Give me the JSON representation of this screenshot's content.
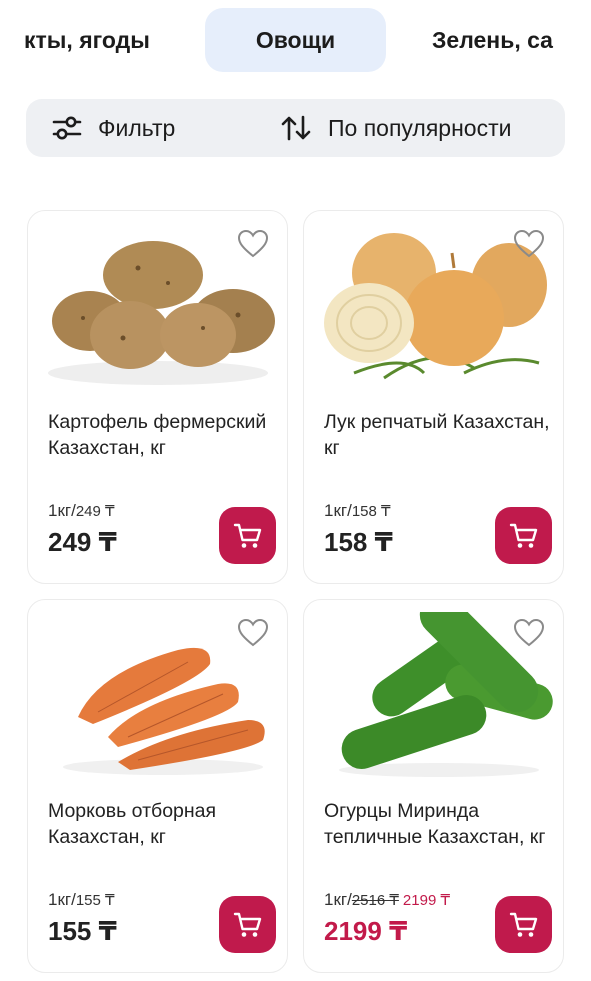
{
  "tabs": [
    {
      "label": "кты, ягоды"
    },
    {
      "label": "Овощи"
    },
    {
      "label": "Зелень, са"
    }
  ],
  "filter_bar": {
    "filter_label": "Фильтр",
    "sort_label": "По популярности"
  },
  "products": [
    {
      "name": "Картофель фермерский Казахстан, кг",
      "per_unit": "1кг/",
      "per_price": "249 ₸",
      "price": "249 ₸"
    },
    {
      "name": "Лук репчатый Казахстан, кг",
      "per_unit": "1кг/",
      "per_price": "158 ₸",
      "price": "158 ₸"
    },
    {
      "name": "Морковь отборная Казахстан, кг",
      "per_unit": "1кг/",
      "per_price": "155 ₸",
      "price": "155 ₸"
    },
    {
      "name": "Огурцы Миринда тепличные Казахстан, кг",
      "per_unit": "1кг/",
      "per_old_price": "2516 ₸",
      "per_price": "2199 ₸",
      "price": "2199 ₸"
    }
  ],
  "colors": {
    "accent": "#c01a4c",
    "sale_price": "#c21a4a",
    "active_tab_bg": "#e6eefb",
    "filter_bg": "#eef0f3"
  },
  "icons": [
    "filter-sliders-icon",
    "sort-arrows-icon",
    "heart-icon",
    "cart-icon"
  ]
}
